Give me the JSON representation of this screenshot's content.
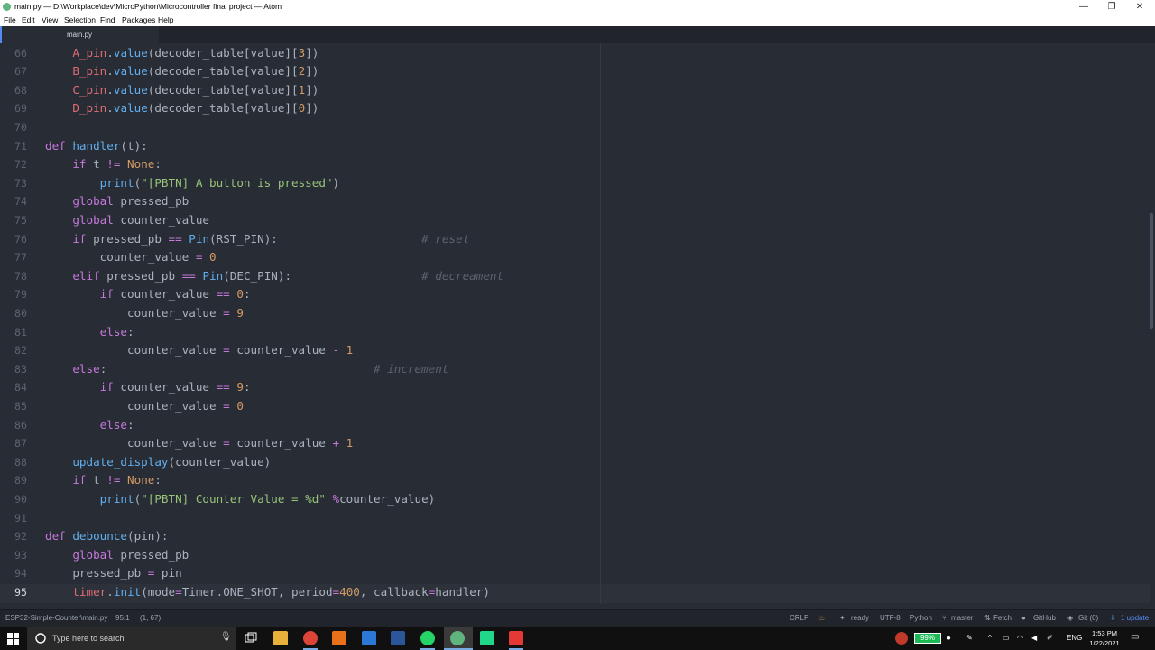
{
  "window": {
    "title": "main.py — D:\\Workplace\\dev\\MicroPython\\Microcontroller final project — Atom",
    "controls": [
      "—",
      "❐",
      "✕"
    ]
  },
  "menu": [
    "File",
    "Edit",
    "View",
    "Selection",
    "Find",
    "Packages",
    "Help"
  ],
  "tab": {
    "label": "main.py"
  },
  "editor": {
    "current_line": "95",
    "lines": [
      {
        "n": "66",
        "text": "    A_pin.value(decoder_table[value][3])"
      },
      {
        "n": "67",
        "text": "    B_pin.value(decoder_table[value][2])"
      },
      {
        "n": "68",
        "text": "    C_pin.value(decoder_table[value][1])"
      },
      {
        "n": "69",
        "text": "    D_pin.value(decoder_table[value][0])"
      },
      {
        "n": "70",
        "text": ""
      },
      {
        "n": "71",
        "text": "def handler(t):"
      },
      {
        "n": "72",
        "text": "    if t != None:"
      },
      {
        "n": "73",
        "text": "        print(\"[PBTN] A button is pressed\")"
      },
      {
        "n": "74",
        "text": "    global pressed_pb"
      },
      {
        "n": "75",
        "text": "    global counter_value"
      },
      {
        "n": "76",
        "text": "    if pressed_pb == Pin(RST_PIN):                     # reset"
      },
      {
        "n": "77",
        "text": "        counter_value = 0"
      },
      {
        "n": "78",
        "text": "    elif pressed_pb == Pin(DEC_PIN):                   # decreament"
      },
      {
        "n": "79",
        "text": "        if counter_value == 0:"
      },
      {
        "n": "80",
        "text": "            counter_value = 9"
      },
      {
        "n": "81",
        "text": "        else:"
      },
      {
        "n": "82",
        "text": "            counter_value = counter_value - 1"
      },
      {
        "n": "83",
        "text": "    else:                                       # increment"
      },
      {
        "n": "84",
        "text": "        if counter_value == 9:"
      },
      {
        "n": "85",
        "text": "            counter_value = 0"
      },
      {
        "n": "86",
        "text": "        else:"
      },
      {
        "n": "87",
        "text": "            counter_value = counter_value + 1"
      },
      {
        "n": "88",
        "text": "    update_display(counter_value)"
      },
      {
        "n": "89",
        "text": "    if t != None:"
      },
      {
        "n": "90",
        "text": "        print(\"[PBTN] Counter Value = %d\" %counter_value)"
      },
      {
        "n": "91",
        "text": ""
      },
      {
        "n": "92",
        "text": "def debounce(pin):"
      },
      {
        "n": "93",
        "text": "    global pressed_pb"
      },
      {
        "n": "94",
        "text": "    pressed_pb = pin"
      },
      {
        "n": "95",
        "text": "    timer.init(mode=Timer.ONE_SHOT, period=400, callback=handler)"
      }
    ]
  },
  "status": {
    "file_path": "ESP32-Simple-Counter\\main.py",
    "cursor": "95:1",
    "selection": "(1, 67)",
    "line_ending": "CRLF",
    "ready": "ready",
    "encoding": "UTF-8",
    "grammar": "Python",
    "branch": "master",
    "fetch": "Fetch",
    "github": "GitHub",
    "git": "Git (0)",
    "update": "1 update"
  },
  "taskbar": {
    "search_placeholder": "Type here to search",
    "battery": "99%",
    "language": "ENG",
    "time": "1:53 PM",
    "date": "1/22/2021"
  },
  "colors": {
    "editor_bg": "#282c34",
    "keyword": "#c678dd",
    "function": "#61afef",
    "variable": "#e06c75",
    "string": "#98c379",
    "number": "#d19a66",
    "comment": "#5c6370"
  }
}
